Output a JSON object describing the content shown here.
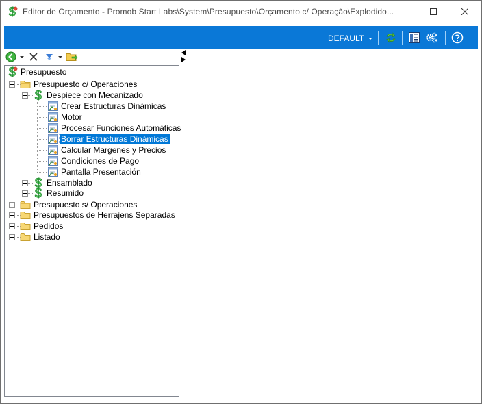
{
  "window": {
    "title": "Editor de Orçamento - Promob Start Labs\\System\\Presupuesto\\Orçamento c/ Operação\\Explodido...",
    "controls": {
      "minimize": "minimize",
      "maximize": "maximize",
      "close": "close"
    }
  },
  "toolbar": {
    "profile": "DEFAULT",
    "accent_color": "#0A78D7",
    "icons": [
      "refresh-icon",
      "layout-icon",
      "settings-icon",
      "help-icon"
    ]
  },
  "tree_toolbar": {
    "icons": [
      "back-icon",
      "dropdown-icon",
      "delete-icon",
      "move-down-icon",
      "dropdown-icon",
      "folder-open-icon"
    ]
  },
  "tree": {
    "root": "Presupuesto",
    "n1": "Presupuesto c/ Operaciones",
    "n1a": "Despiece con Mecanizado",
    "n1a1": "Crear Estructuras Dinámicas",
    "n1a2": "Motor",
    "n1a3": "Procesar Funciones Automáticas",
    "n1a4": "Borrar Estructuras Dinámicas",
    "n1a5": "Calcular Margenes y Precios",
    "n1a6": "Condiciones de Pago",
    "n1a7": "Pantalla Presentación",
    "n1b": "Ensamblado",
    "n1c": "Resumido",
    "n2": "Presupuesto s/ Operaciones",
    "n3": "Presupuestos de Herrajens Separadas",
    "n4": "Pedidos",
    "n5": "Listado",
    "selected": "Borrar Estructuras Dinámicas"
  }
}
